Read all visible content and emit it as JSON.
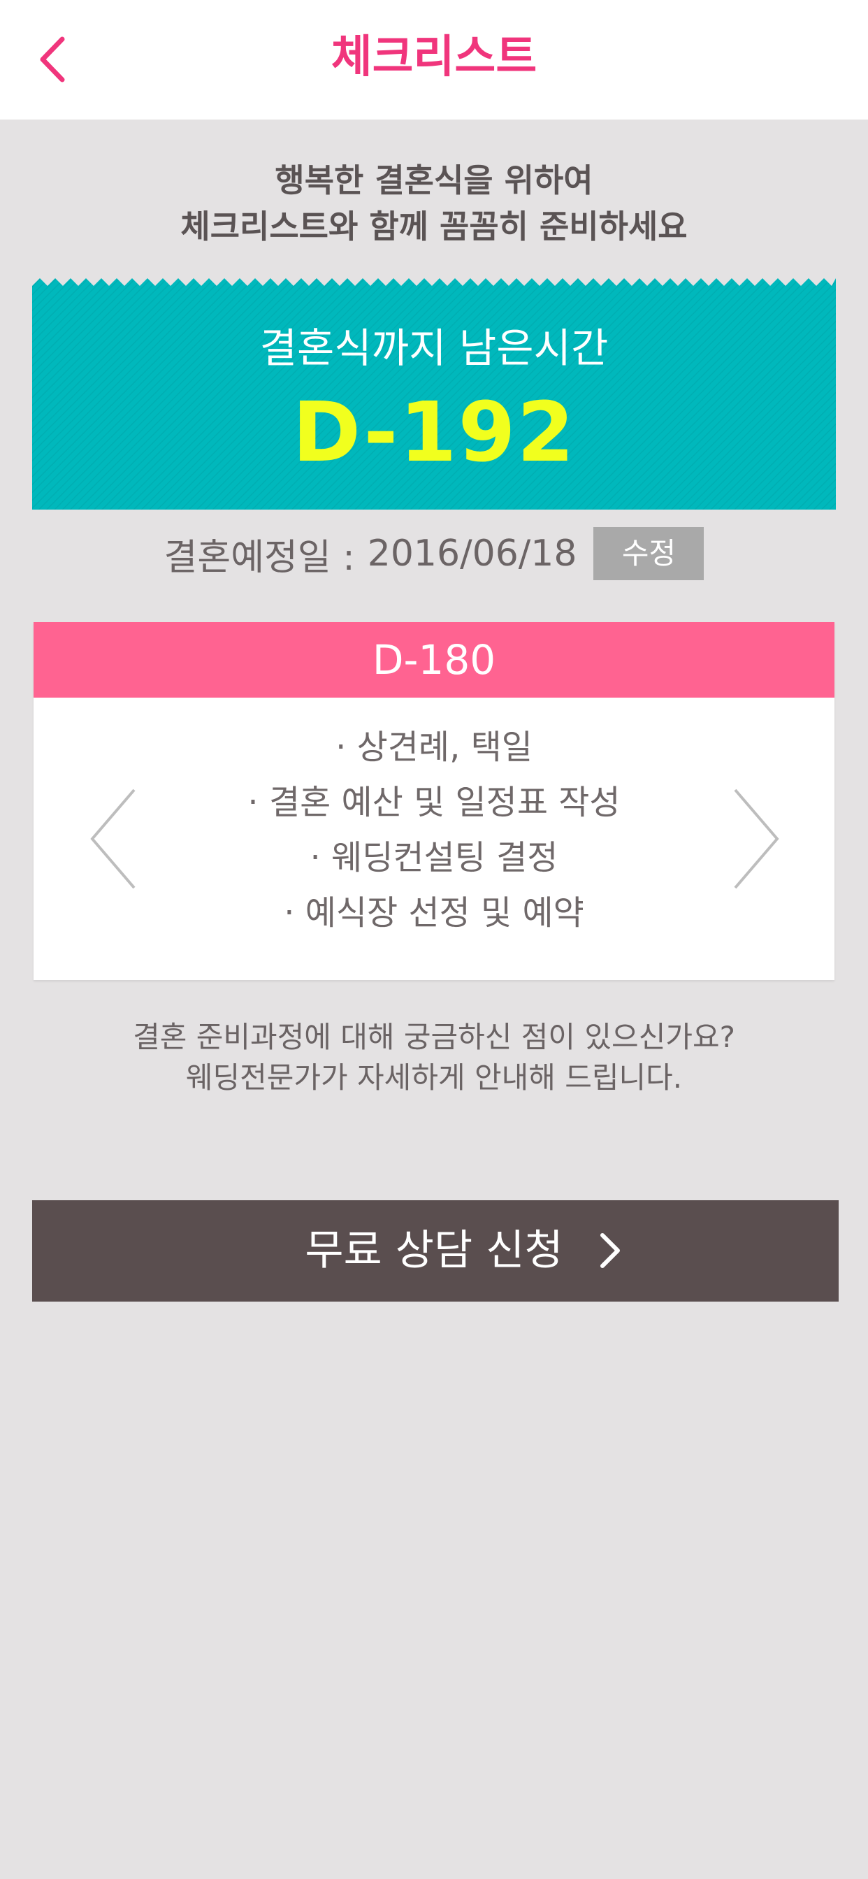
{
  "header": {
    "title": "체크리스트",
    "accent_color": "#f0357c",
    "back_icon": "chevron-left-icon"
  },
  "intro": {
    "line1": "행복한 결혼식을 위하여",
    "line2": "체크리스트와 함께 꼼꼼히 준비하세요"
  },
  "countdown": {
    "label": "결혼식까지 남은시간",
    "value": "D-192",
    "card_color": "#00b8bc",
    "value_color": "#f1ff1e"
  },
  "wedding_date": {
    "label": "결혼예정일 :",
    "value": "2016/06/18",
    "edit_label": "수정"
  },
  "checklist": {
    "header": "D-180",
    "header_color": "#ff6391",
    "items": [
      "· 상견례, 택일",
      "· 결혼 예산 및 일정표 작성",
      "· 웨딩컨설팅 결정",
      "· 예식장 선정 및 예약"
    ],
    "prev_icon": "chevron-left-icon",
    "next_icon": "chevron-right-icon"
  },
  "consult": {
    "line1": "결혼 준비과정에 대해 궁금하신 점이 있으신가요?",
    "line2": "웨딩전문가가 자세하게 안내해 드립니다.",
    "button_label": "무료 상담 신청",
    "button_color": "#5a4e4f",
    "button_icon": "chevron-right-icon"
  }
}
